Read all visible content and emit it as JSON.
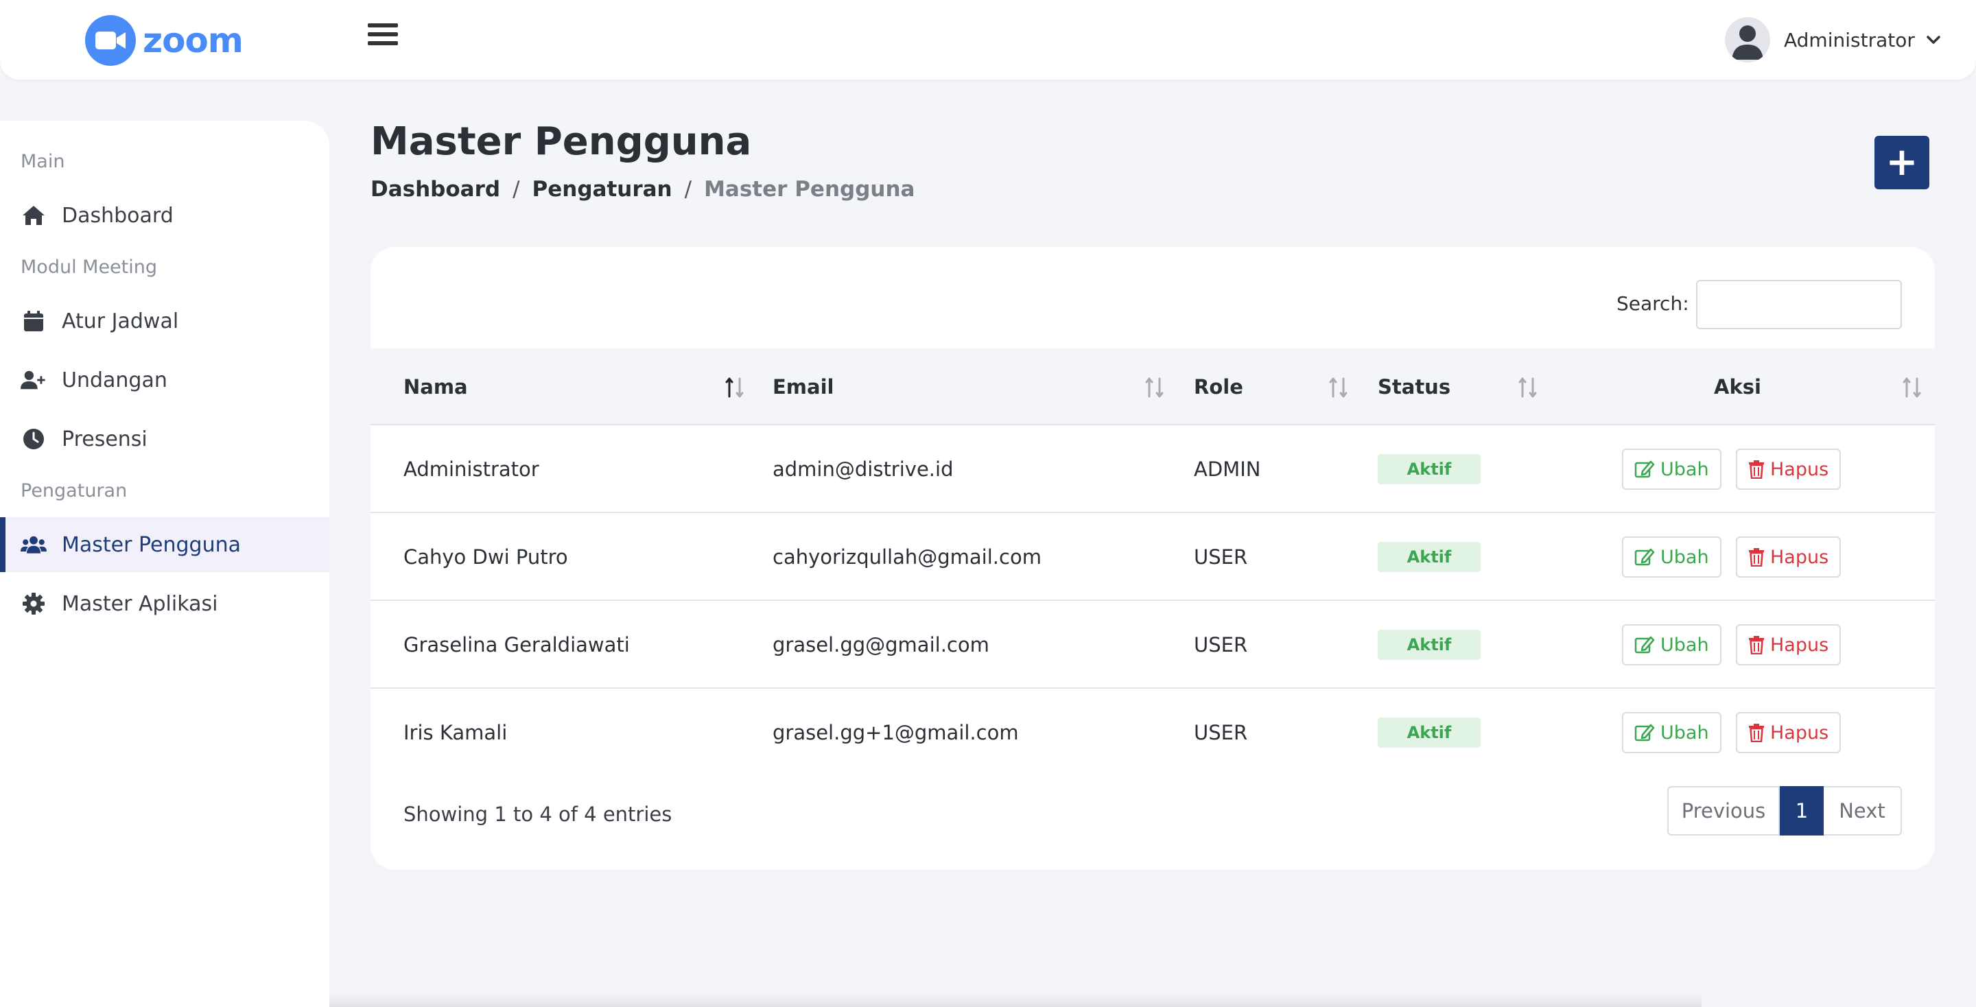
{
  "app": {
    "logo_text": "zoom",
    "brand_color": "#4a8cf7",
    "accent_color": "#1f3c7a"
  },
  "header": {
    "user_name": "Administrator"
  },
  "sidebar": {
    "sections": [
      "Main",
      "Modul Meeting",
      "Pengaturan"
    ],
    "items": [
      {
        "label": "Dashboard",
        "icon": "home-icon"
      },
      {
        "label": "Atur Jadwal",
        "icon": "calendar-icon"
      },
      {
        "label": "Undangan",
        "icon": "user-plus-icon"
      },
      {
        "label": "Presensi",
        "icon": "clock-icon"
      },
      {
        "label": "Master Pengguna",
        "icon": "users-icon",
        "active": true
      },
      {
        "label": "Master Aplikasi",
        "icon": "gear-icon"
      }
    ]
  },
  "page": {
    "title": "Master Pengguna",
    "breadcrumb": [
      "Dashboard",
      "Pengaturan",
      "Master Pengguna"
    ],
    "add_label": "+"
  },
  "table": {
    "search_label": "Search:",
    "search_value": "",
    "columns": [
      "Nama",
      "Email",
      "Role",
      "Status",
      "Aksi"
    ],
    "rows": [
      {
        "nama": "Administrator",
        "email": "admin@distrive.id",
        "role": "ADMIN",
        "status": "Aktif"
      },
      {
        "nama": "Cahyo Dwi Putro",
        "email": "cahyorizqullah@gmail.com",
        "role": "USER",
        "status": "Aktif"
      },
      {
        "nama": "Graselina Geraldiawati",
        "email": "grasel.gg@gmail.com",
        "role": "USER",
        "status": "Aktif"
      },
      {
        "nama": "Iris Kamali",
        "email": "grasel.gg+1@gmail.com",
        "role": "USER",
        "status": "Aktif"
      }
    ],
    "edit_label": "Ubah",
    "delete_label": "Hapus",
    "info": "Showing 1 to 4 of 4 entries",
    "pagination": {
      "previous": "Previous",
      "current": "1",
      "next": "Next"
    }
  }
}
